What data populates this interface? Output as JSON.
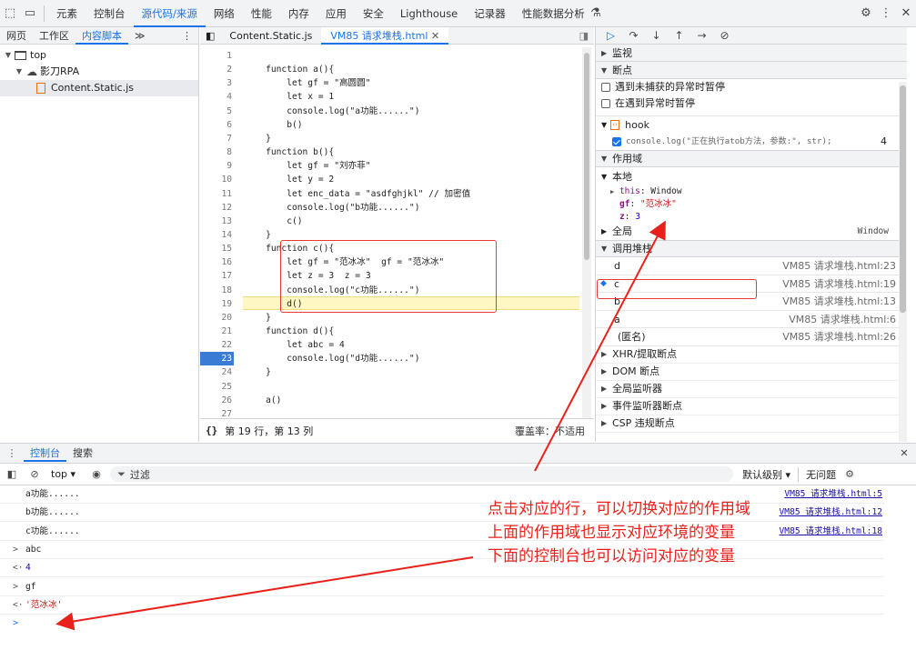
{
  "topbar": {
    "tabs": [
      "元素",
      "控制台",
      "源代码/来源",
      "网络",
      "性能",
      "内存",
      "应用",
      "安全",
      "Lighthouse",
      "记录器",
      "性能数据分析"
    ],
    "active_tab": "源代码/来源"
  },
  "navigator": {
    "tabs": [
      "网页",
      "工作区",
      "内容脚本"
    ],
    "active_tab": "内容脚本",
    "more": "≫",
    "tree": [
      {
        "label": "top",
        "depth": 0
      },
      {
        "label": "影刀RPA",
        "depth": 1
      },
      {
        "label": "Content.Static.js",
        "depth": 2
      }
    ]
  },
  "editor": {
    "tabs": [
      "Content.Static.js",
      "VM85 请求堆栈.html"
    ],
    "active_tab": "VM85 请求堆栈.html",
    "lines": [
      {
        "n": "1",
        "code": ""
      },
      {
        "n": "2",
        "code": "    function a(){"
      },
      {
        "n": "3",
        "code": "        let gf = \"高圆圆\""
      },
      {
        "n": "4",
        "code": "        let x = 1"
      },
      {
        "n": "5",
        "code": "        console.log(\"a功能......\")"
      },
      {
        "n": "6",
        "code": "        b()"
      },
      {
        "n": "7",
        "code": "    }"
      },
      {
        "n": "8",
        "code": "    function b(){"
      },
      {
        "n": "9",
        "code": "        let gf = \"刘亦菲\""
      },
      {
        "n": "10",
        "code": "        let y = 2"
      },
      {
        "n": "11",
        "code": "        let enc_data = \"asdfghjkl\" // 加密值"
      },
      {
        "n": "12",
        "code": "        console.log(\"b功能......\")"
      },
      {
        "n": "13",
        "code": "        c()"
      },
      {
        "n": "14",
        "code": "    }"
      },
      {
        "n": "15",
        "code": "    function c(){"
      },
      {
        "n": "16",
        "code": "        let gf = \"范冰冰\"  gf = \"范冰冰\""
      },
      {
        "n": "17",
        "code": "        let z = 3  z = 3"
      },
      {
        "n": "18",
        "code": "        console.log(\"c功能......\")"
      },
      {
        "n": "19",
        "code": "        d()"
      },
      {
        "n": "20",
        "code": "    }"
      },
      {
        "n": "21",
        "code": "    function d(){"
      },
      {
        "n": "22",
        "code": "        let abc = 4"
      },
      {
        "n": "23",
        "code": "        console.log(\"d功能......\")"
      },
      {
        "n": "24",
        "code": "    }"
      },
      {
        "n": "25",
        "code": ""
      },
      {
        "n": "26",
        "code": "    a()"
      },
      {
        "n": "27",
        "code": ""
      }
    ],
    "status_brace": "{}",
    "status_position": "第 19 行，第 13 列",
    "status_coverage": "覆盖率：不适用"
  },
  "debugger": {
    "watch": "监视",
    "breakpoints": "断点",
    "bp_options": [
      "遇到未捕获的异常时暂停",
      "在遇到异常时暂停"
    ],
    "hook": {
      "name": "hook",
      "code": "console.log(\"正在执行atob方法，参数:\", str);",
      "line": "4"
    },
    "scope_title": "作用域",
    "local_title": "本地",
    "local_vars": [
      {
        "name": "this",
        "value": "Window"
      },
      {
        "name": "gf",
        "value": "\"范冰冰\""
      },
      {
        "name": "z",
        "value": "3"
      }
    ],
    "global_title": "全局",
    "global_value": "Window",
    "callstack_title": "调用堆栈",
    "callstack": [
      {
        "fn": "d",
        "loc": "VM85 请求堆栈.html:23"
      },
      {
        "fn": "c",
        "loc": "VM85 请求堆栈.html:19"
      },
      {
        "fn": "b",
        "loc": "VM85 请求堆栈.html:13"
      },
      {
        "fn": "a",
        "loc": "VM85 请求堆栈.html:6"
      },
      {
        "fn": "(匿名)",
        "loc": "VM85 请求堆栈.html:26"
      }
    ],
    "more_sections": [
      "XHR/提取断点",
      "DOM 断点",
      "全局监听器",
      "事件监听器断点",
      "CSP 违规断点"
    ]
  },
  "drawer": {
    "tabs": [
      "控制台",
      "搜索"
    ],
    "active_tab": "控制台",
    "context": "top",
    "filter_placeholder": "过滤",
    "level": "默认级别",
    "issues": "无问题",
    "messages": [
      {
        "prefix": "",
        "text": "a功能......",
        "src": "VM85 请求堆栈.html:5"
      },
      {
        "prefix": "",
        "text": "b功能......",
        "src": "VM85 请求堆栈.html:12"
      },
      {
        "prefix": "",
        "text": "c功能......",
        "src": "VM85 请求堆栈.html:18"
      },
      {
        "prefix": ">",
        "text": "abc",
        "src": ""
      },
      {
        "prefix": "<·",
        "text": "4",
        "src": ""
      },
      {
        "prefix": ">",
        "text": "gf",
        "src": ""
      },
      {
        "prefix": "<·",
        "text": "'范冰冰'",
        "src": ""
      }
    ],
    "prompt": ">"
  },
  "annotation": {
    "lines": [
      "点击对应的行，可以切换对应的作用域",
      "上面的作用域也显示对应环境的变量",
      "下面的控制台也可以访问对应的变量"
    ],
    "color": "#e8221b"
  }
}
